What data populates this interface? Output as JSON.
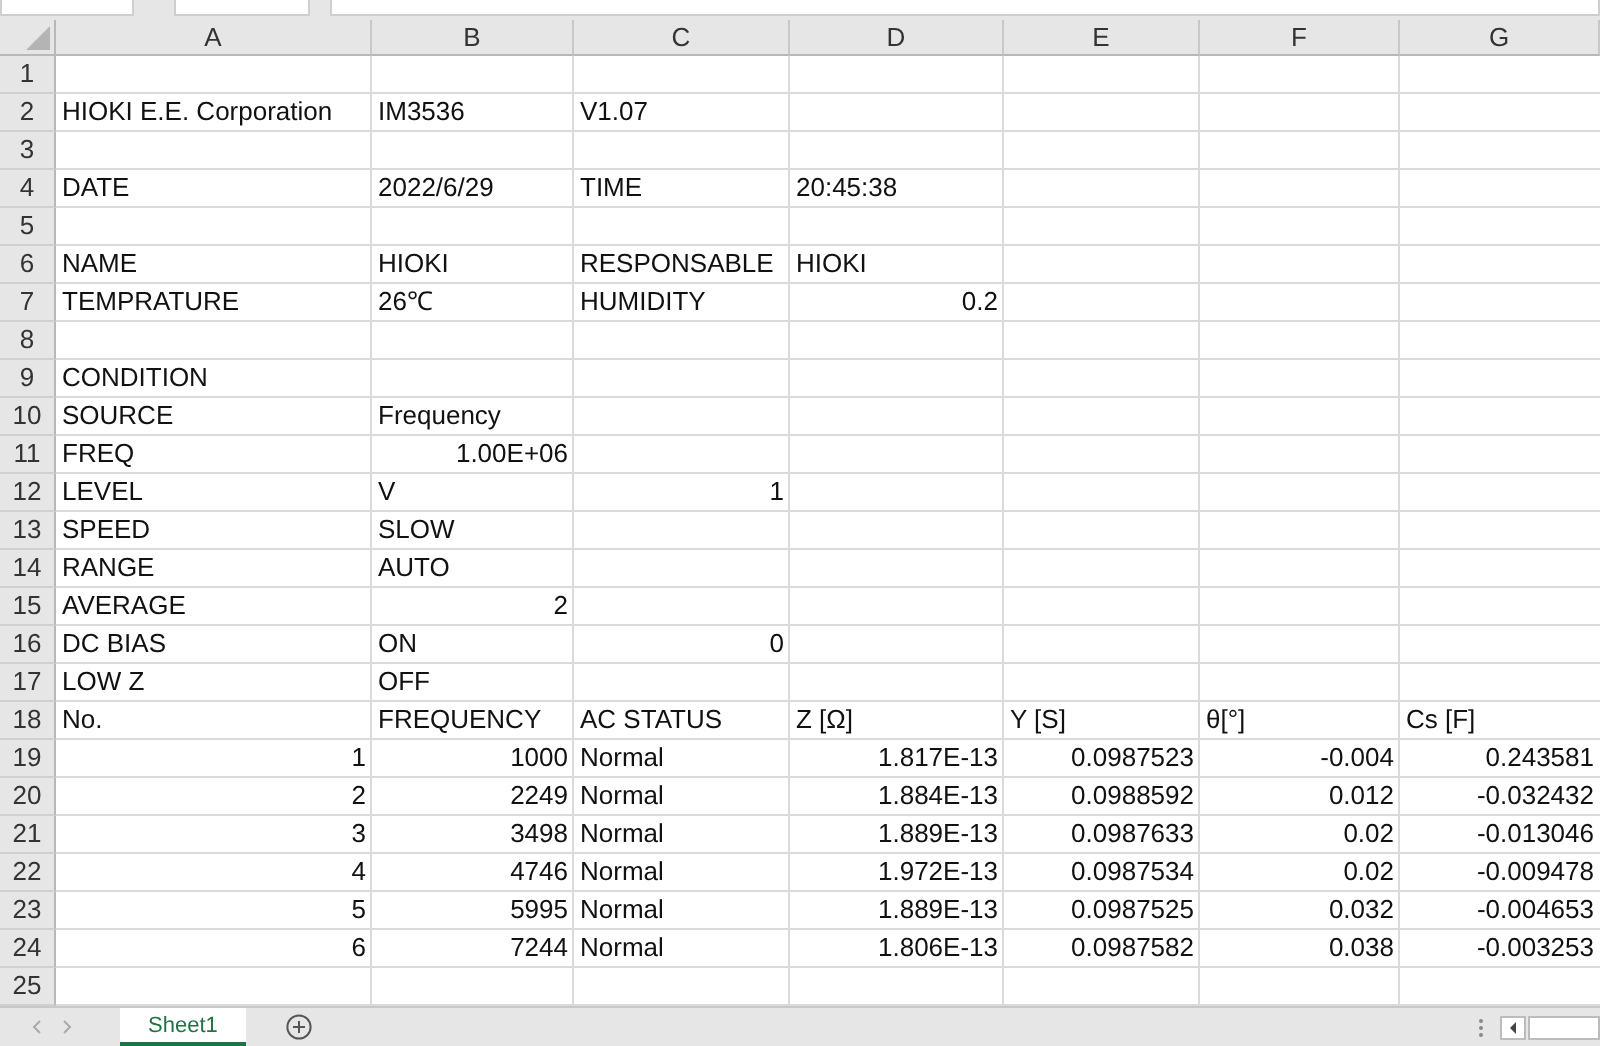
{
  "columns": [
    "A",
    "B",
    "C",
    "D",
    "E",
    "F",
    "G"
  ],
  "rows": [
    {
      "number": "1",
      "cells": {}
    },
    {
      "number": "2",
      "cells": {
        "A": {
          "text": "HIOKI E.E. Corporation",
          "kind": "text"
        },
        "B": {
          "text": "IM3536",
          "kind": "text"
        },
        "C": {
          "text": "V1.07",
          "kind": "text"
        }
      }
    },
    {
      "number": "3",
      "cells": {}
    },
    {
      "number": "4",
      "cells": {
        "A": {
          "text": "DATE",
          "kind": "text"
        },
        "B": {
          "text": "2022/6/29",
          "kind": "text"
        },
        "C": {
          "text": "TIME",
          "kind": "text"
        },
        "D": {
          "text": "20:45:38",
          "kind": "text"
        }
      }
    },
    {
      "number": "5",
      "cells": {}
    },
    {
      "number": "6",
      "cells": {
        "A": {
          "text": "NAME",
          "kind": "text"
        },
        "B": {
          "text": "HIOKI",
          "kind": "text"
        },
        "C": {
          "text": "RESPONSABLE",
          "kind": "text"
        },
        "D": {
          "text": "HIOKI",
          "kind": "text"
        }
      }
    },
    {
      "number": "7",
      "cells": {
        "A": {
          "text": "TEMPRATURE",
          "kind": "text"
        },
        "B": {
          "text": "26℃",
          "kind": "text"
        },
        "C": {
          "text": "HUMIDITY",
          "kind": "text"
        },
        "D": {
          "text": "0.2",
          "kind": "number"
        }
      }
    },
    {
      "number": "8",
      "cells": {}
    },
    {
      "number": "9",
      "cells": {
        "A": {
          "text": "CONDITION",
          "kind": "text"
        }
      }
    },
    {
      "number": "10",
      "cells": {
        "A": {
          "text": "SOURCE",
          "kind": "text"
        },
        "B": {
          "text": "Frequency",
          "kind": "text"
        }
      }
    },
    {
      "number": "11",
      "cells": {
        "A": {
          "text": "FREQ",
          "kind": "text"
        },
        "B": {
          "text": "1.00E+06",
          "kind": "number"
        }
      }
    },
    {
      "number": "12",
      "cells": {
        "A": {
          "text": "LEVEL",
          "kind": "text"
        },
        "B": {
          "text": "V",
          "kind": "text"
        },
        "C": {
          "text": "1",
          "kind": "number"
        }
      }
    },
    {
      "number": "13",
      "cells": {
        "A": {
          "text": "SPEED",
          "kind": "text"
        },
        "B": {
          "text": "SLOW",
          "kind": "text"
        }
      }
    },
    {
      "number": "14",
      "cells": {
        "A": {
          "text": "RANGE",
          "kind": "text"
        },
        "B": {
          "text": "AUTO",
          "kind": "text"
        }
      }
    },
    {
      "number": "15",
      "cells": {
        "A": {
          "text": "AVERAGE",
          "kind": "text"
        },
        "B": {
          "text": "2",
          "kind": "number"
        }
      }
    },
    {
      "number": "16",
      "cells": {
        "A": {
          "text": "DC BIAS",
          "kind": "text"
        },
        "B": {
          "text": "ON",
          "kind": "text"
        },
        "C": {
          "text": "0",
          "kind": "number"
        }
      }
    },
    {
      "number": "17",
      "cells": {
        "A": {
          "text": "LOW Z",
          "kind": "text"
        },
        "B": {
          "text": "OFF",
          "kind": "text"
        }
      }
    },
    {
      "number": "18",
      "cells": {
        "A": {
          "text": "No.",
          "kind": "text"
        },
        "B": {
          "text": "FREQUENCY",
          "kind": "text"
        },
        "C": {
          "text": "AC STATUS",
          "kind": "text"
        },
        "D": {
          "text": "Z [Ω]",
          "kind": "text"
        },
        "E": {
          "text": "Y [S]",
          "kind": "text"
        },
        "F": {
          "text": "θ[°]",
          "kind": "text"
        },
        "G": {
          "text": "Cs [F]",
          "kind": "text"
        }
      }
    },
    {
      "number": "19",
      "cells": {
        "A": {
          "text": "1",
          "kind": "number"
        },
        "B": {
          "text": "1000",
          "kind": "number"
        },
        "C": {
          "text": "Normal",
          "kind": "text"
        },
        "D": {
          "text": "1.817E-13",
          "kind": "number"
        },
        "E": {
          "text": "0.0987523",
          "kind": "number"
        },
        "F": {
          "text": "-0.004",
          "kind": "number"
        },
        "G": {
          "text": "0.243581",
          "kind": "number"
        }
      }
    },
    {
      "number": "20",
      "cells": {
        "A": {
          "text": "2",
          "kind": "number"
        },
        "B": {
          "text": "2249",
          "kind": "number"
        },
        "C": {
          "text": "Normal",
          "kind": "text"
        },
        "D": {
          "text": "1.884E-13",
          "kind": "number"
        },
        "E": {
          "text": "0.0988592",
          "kind": "number"
        },
        "F": {
          "text": "0.012",
          "kind": "number"
        },
        "G": {
          "text": "-0.032432",
          "kind": "number"
        }
      }
    },
    {
      "number": "21",
      "cells": {
        "A": {
          "text": "3",
          "kind": "number"
        },
        "B": {
          "text": "3498",
          "kind": "number"
        },
        "C": {
          "text": "Normal",
          "kind": "text"
        },
        "D": {
          "text": "1.889E-13",
          "kind": "number"
        },
        "E": {
          "text": "0.0987633",
          "kind": "number"
        },
        "F": {
          "text": "0.02",
          "kind": "number"
        },
        "G": {
          "text": "-0.013046",
          "kind": "number"
        }
      }
    },
    {
      "number": "22",
      "cells": {
        "A": {
          "text": "4",
          "kind": "number"
        },
        "B": {
          "text": "4746",
          "kind": "number"
        },
        "C": {
          "text": "Normal",
          "kind": "text"
        },
        "D": {
          "text": "1.972E-13",
          "kind": "number"
        },
        "E": {
          "text": "0.0987534",
          "kind": "number"
        },
        "F": {
          "text": "0.02",
          "kind": "number"
        },
        "G": {
          "text": "-0.009478",
          "kind": "number"
        }
      }
    },
    {
      "number": "23",
      "cells": {
        "A": {
          "text": "5",
          "kind": "number"
        },
        "B": {
          "text": "5995",
          "kind": "number"
        },
        "C": {
          "text": "Normal",
          "kind": "text"
        },
        "D": {
          "text": "1.889E-13",
          "kind": "number"
        },
        "E": {
          "text": "0.0987525",
          "kind": "number"
        },
        "F": {
          "text": "0.032",
          "kind": "number"
        },
        "G": {
          "text": "-0.004653",
          "kind": "number"
        }
      }
    },
    {
      "number": "24",
      "cells": {
        "A": {
          "text": "6",
          "kind": "number"
        },
        "B": {
          "text": "7244",
          "kind": "number"
        },
        "C": {
          "text": "Normal",
          "kind": "text"
        },
        "D": {
          "text": "1.806E-13",
          "kind": "number"
        },
        "E": {
          "text": "0.0987582",
          "kind": "number"
        },
        "F": {
          "text": "0.038",
          "kind": "number"
        },
        "G": {
          "text": "-0.003253",
          "kind": "number"
        }
      }
    },
    {
      "number": "25",
      "cells": {}
    }
  ],
  "sheets": [
    {
      "label": "Sheet1",
      "selected": true
    }
  ]
}
